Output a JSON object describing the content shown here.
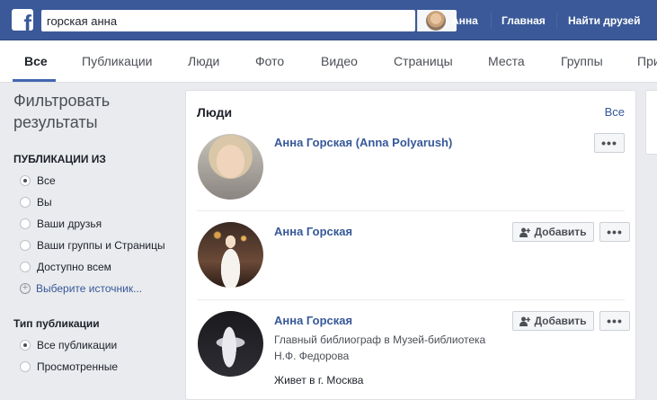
{
  "header": {
    "logo": "f",
    "search_value": "горская анна",
    "profile_name": "Анна",
    "nav_home": "Главная",
    "nav_find_friends": "Найти друзей"
  },
  "tabs": [
    "Все",
    "Публикации",
    "Люди",
    "Фото",
    "Видео",
    "Страницы",
    "Места",
    "Группы",
    "При"
  ],
  "filters": {
    "title_line1": "Фильтровать",
    "title_line2": "результаты",
    "posts_from_title": "ПУБЛИКАЦИИ ИЗ",
    "posts_from_options": [
      "Все",
      "Вы",
      "Ваши друзья",
      "Ваши группы и Страницы",
      "Доступно всем"
    ],
    "choose_source": "Выберите источник...",
    "post_type_title": "Тип публикации",
    "post_type_options": [
      "Все публикации",
      "Просмотренные"
    ]
  },
  "results": {
    "section_title": "Люди",
    "see_all": "Все",
    "add_label": "Добавить",
    "more_label": "•••",
    "people": [
      {
        "name": "Анна Горская (Anna Polyarush)"
      },
      {
        "name": "Анна Горская"
      },
      {
        "name": "Анна Горская",
        "detail_line1": "Главный библиограф в Музей-библиотека",
        "detail_line2": "Н.Ф. Федорова",
        "lives_in": "Живет в г. Москва"
      }
    ]
  },
  "colors": {
    "brand": "#3b5998",
    "link": "#365899",
    "tab_underline": "#4267b2"
  }
}
